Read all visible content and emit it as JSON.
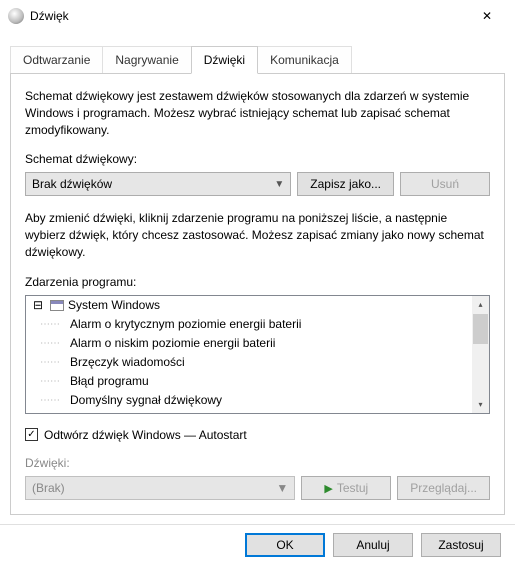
{
  "window": {
    "title": "Dźwięk",
    "close": "✕"
  },
  "tabs": {
    "t0": "Odtwarzanie",
    "t1": "Nagrywanie",
    "t2": "Dźwięki",
    "t3": "Komunikacja"
  },
  "scheme": {
    "desc": "Schemat dźwiękowy jest zestawem dźwięków stosowanych dla zdarzeń w systemie Windows i programach. Możesz wybrać istniejący schemat lub zapisać schemat zmodyfikowany.",
    "label": "Schemat dźwiękowy:",
    "value": "Brak dźwięków",
    "save_as": "Zapisz jako...",
    "delete": "Usuń"
  },
  "events": {
    "desc": "Aby zmienić dźwięki, kliknij zdarzenie programu na poniższej liście, a następnie wybierz dźwięk, który chcesz zastosować. Możesz zapisać zmiany jako nowy schemat dźwiękowy.",
    "label": "Zdarzenia programu:",
    "root": "System Windows",
    "items": [
      "Alarm o krytycznym poziomie energii baterii",
      "Alarm o niskim poziomie energii baterii",
      "Brzęczyk wiadomości",
      "Błąd programu",
      "Domyślny sygnał dźwiękowy"
    ]
  },
  "autostart": {
    "checked": true,
    "label": "Odtwórz dźwięk Windows — Autostart"
  },
  "sound": {
    "label": "Dźwięki:",
    "value": "(Brak)",
    "test": "Testuj",
    "browse": "Przeglądaj..."
  },
  "footer": {
    "ok": "OK",
    "cancel": "Anuluj",
    "apply": "Zastosuj"
  }
}
